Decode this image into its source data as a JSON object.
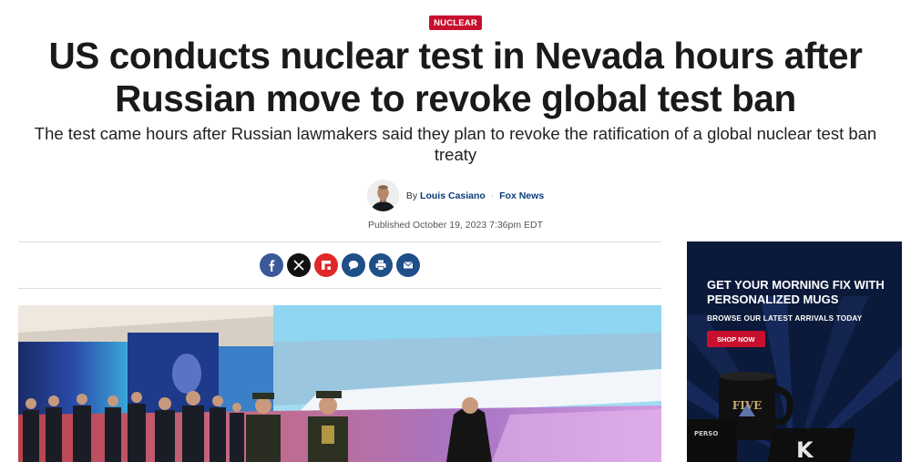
{
  "article": {
    "category": "NUCLEAR",
    "headline": "US conducts nuclear test in Nevada hours after Russian move to revoke global test ban",
    "subhead": "The test came hours after Russian lawmakers said they plan to revoke the ratification of a global nuclear test ban treaty",
    "byline": {
      "prefix": "By",
      "author": "Louis Casiano",
      "separator": "·",
      "outlet": "Fox News"
    },
    "published": "Published October 19, 2023 7:36pm EDT"
  },
  "share": [
    {
      "name": "facebook-icon",
      "color": "#3b5998"
    },
    {
      "name": "x-icon",
      "color": "#111111"
    },
    {
      "name": "flipboard-icon",
      "color": "#e12828"
    },
    {
      "name": "comment-icon",
      "color": "#1f4e89"
    },
    {
      "name": "print-icon",
      "color": "#1f4e89"
    },
    {
      "name": "email-icon",
      "color": "#1f4e89"
    }
  ],
  "ad": {
    "title": "GET YOUR MORNING FIX WITH PERSONALIZED MUGS",
    "subtitle": "BROWSE OUR LATEST ARRIVALS TODAY",
    "cta": "SHOP NOW",
    "mug_text": "FIVE",
    "mug_text2": "PERSO"
  },
  "colors": {
    "brand_red": "#c8102e",
    "link_blue": "#0a3b7a",
    "ad_navy": "#0b1a3a"
  }
}
